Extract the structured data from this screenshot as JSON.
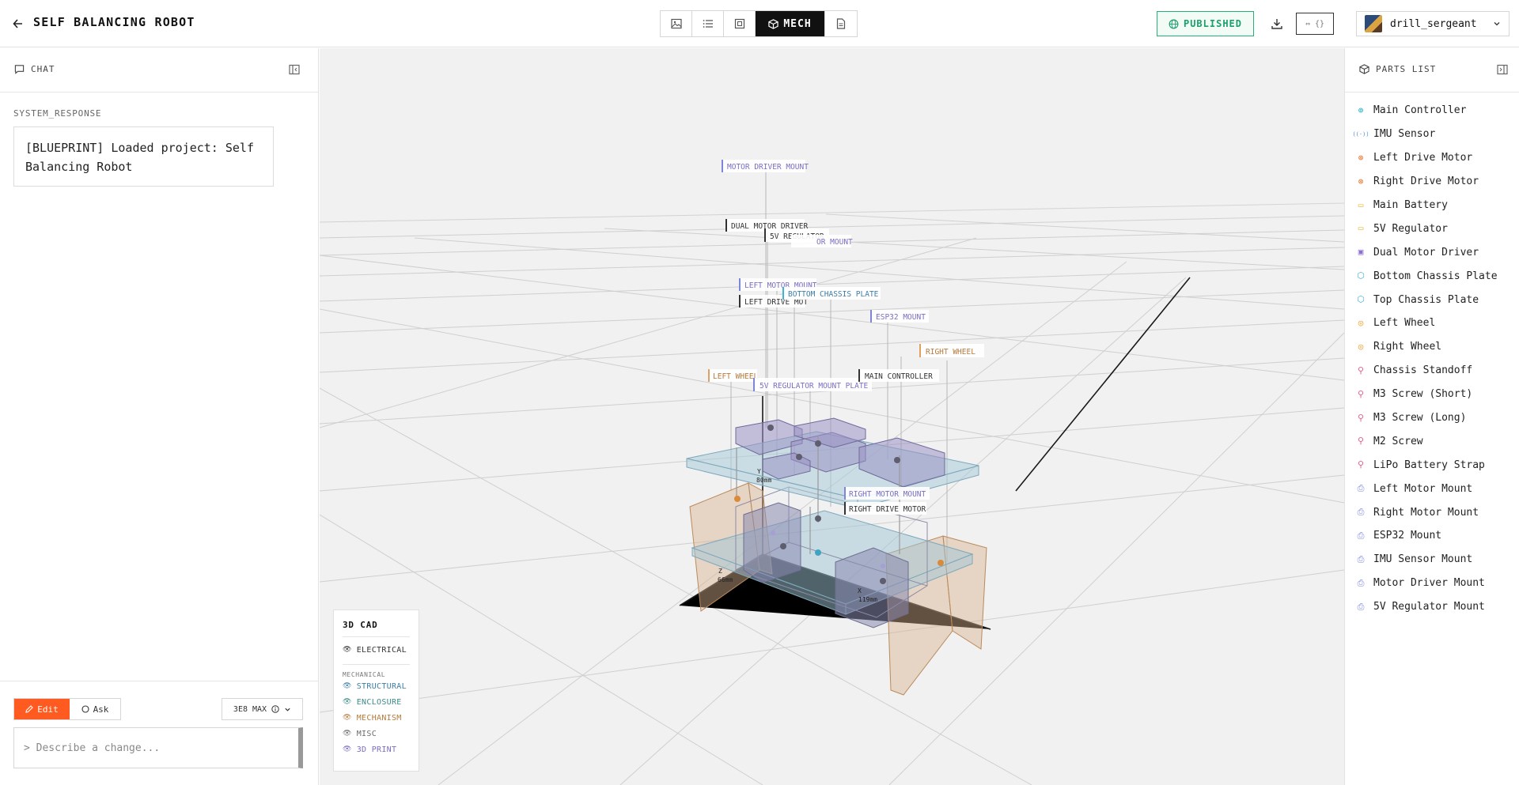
{
  "header": {
    "title": "SELF BALANCING ROBOT",
    "mech_label": "MECH",
    "published_label": "PUBLISHED",
    "code_label": "⇔ {}",
    "username": "drill_sergeant"
  },
  "chat": {
    "title": "CHAT",
    "system_label": "SYSTEM_RESPONSE",
    "system_message": "[BLUEPRINT] Loaded project: Self Balancing Robot",
    "edit_label": "Edit",
    "ask_label": "Ask",
    "model_label": "3E8 MAX",
    "input_placeholder": "> Describe a change..."
  },
  "layers": {
    "title": "3D CAD",
    "electrical": "ELECTRICAL",
    "mechanical_heading": "MECHANICAL",
    "items": [
      {
        "label": "STRUCTURAL",
        "color": "#3d7fa6"
      },
      {
        "label": "ENCLOSURE",
        "color": "#3f8a8a"
      },
      {
        "label": "MECHANISM",
        "color": "#b57a3c"
      },
      {
        "label": "MISC",
        "color": "#6b6b6b"
      },
      {
        "label": "3D PRINT",
        "color": "#7a6fc2"
      }
    ]
  },
  "parts": {
    "title": "PARTS LIST",
    "items": [
      {
        "label": "Main Controller",
        "icon": "chip-icon",
        "color": "#1fb5c9"
      },
      {
        "label": "IMU Sensor",
        "icon": "sensor-icon",
        "color": "#4a8fd6"
      },
      {
        "label": "Left Drive Motor",
        "icon": "motor-icon",
        "color": "#ee7d3a"
      },
      {
        "label": "Right Drive Motor",
        "icon": "motor-icon",
        "color": "#ee7d3a"
      },
      {
        "label": "Main Battery",
        "icon": "battery-icon",
        "color": "#e8b832"
      },
      {
        "label": "5V Regulator",
        "icon": "power-icon",
        "color": "#e8b832"
      },
      {
        "label": "Dual Motor Driver",
        "icon": "board-icon",
        "color": "#8d6fd0"
      },
      {
        "label": "Bottom Chassis Plate",
        "icon": "cube-icon",
        "color": "#3fb3d6"
      },
      {
        "label": "Top Chassis Plate",
        "icon": "cube-icon",
        "color": "#3fb3d6"
      },
      {
        "label": "Left Wheel",
        "icon": "wheel-icon",
        "color": "#f0a23a"
      },
      {
        "label": "Right Wheel",
        "icon": "wheel-icon",
        "color": "#f0a23a"
      },
      {
        "label": "Chassis Standoff",
        "icon": "wrench-icon",
        "color": "#e8608c"
      },
      {
        "label": "M3 Screw (Short)",
        "icon": "wrench-icon",
        "color": "#e8608c"
      },
      {
        "label": "M3 Screw (Long)",
        "icon": "wrench-icon",
        "color": "#e8608c"
      },
      {
        "label": "M2 Screw",
        "icon": "wrench-icon",
        "color": "#e8608c"
      },
      {
        "label": "LiPo Battery Strap",
        "icon": "wrench-icon",
        "color": "#e8608c"
      },
      {
        "label": "Left Motor Mount",
        "icon": "printer-icon",
        "color": "#7d86d8"
      },
      {
        "label": "Right Motor Mount",
        "icon": "printer-icon",
        "color": "#7d86d8"
      },
      {
        "label": "ESP32 Mount",
        "icon": "printer-icon",
        "color": "#7d86d8"
      },
      {
        "label": "IMU Sensor Mount",
        "icon": "printer-icon",
        "color": "#7d86d8"
      },
      {
        "label": "Motor Driver Mount",
        "icon": "printer-icon",
        "color": "#7d86d8"
      },
      {
        "label": "5V Regulator Mount",
        "icon": "printer-icon",
        "color": "#7d86d8"
      }
    ]
  },
  "scene_labels": {
    "motor_driver_mount": "MOTOR DRIVER MOUNT",
    "dual_motor_driver": "DUAL MOTOR DRIVER",
    "regulator_5v": "5V REGULATOR",
    "imu_mount_partial": "OR MOUNT",
    "left_motor_mount": "LEFT MOTOR MOUNT",
    "left_drive_motor": "LEFT DRIVE MOT",
    "bottom_chassis_plate": "BOTTOM CHASSIS PLATE",
    "esp32_mount": "ESP32 MOUNT",
    "right_wheel": "RIGHT WHEEL",
    "left_wheel": "LEFT WHEEL",
    "regulator_mount_plate": "5V REGULATOR MOUNT PLATE",
    "main_controller": "MAIN CONTROLLER",
    "right_motor_mount": "RIGHT MOTOR MOUNT",
    "right_drive_motor": "RIGHT DRIVE MOTOR",
    "axis_y": "Y",
    "axis_y_dim": "80mm",
    "axis_z": "Z",
    "axis_z_dim": "66mm",
    "axis_x": "X",
    "axis_x_dim": "119mm"
  }
}
